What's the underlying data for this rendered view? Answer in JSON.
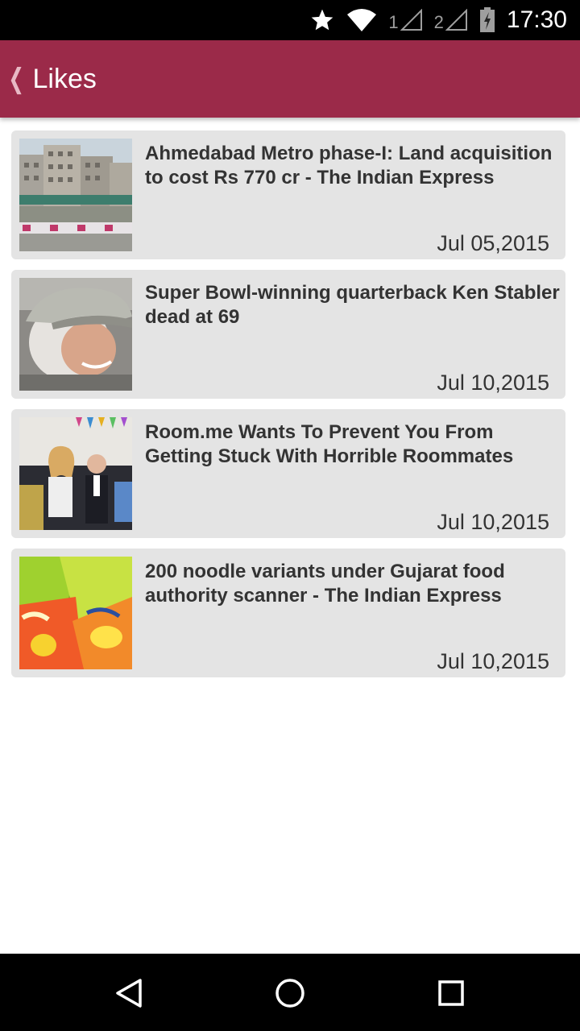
{
  "status_bar": {
    "time": "17:30",
    "sim1": "1",
    "sim2": "2",
    "icons": [
      "star-icon",
      "wifi-icon",
      "signal-icon",
      "signal-icon",
      "battery-charging-icon"
    ]
  },
  "app_bar": {
    "title": "Likes",
    "back_icon": "chevron-left-icon"
  },
  "articles": [
    {
      "title": "Ahmedabad Metro phase-I: Land acquisition to cost Rs 770 cr - The Indian Express",
      "date": "Jul 05,2015"
    },
    {
      "title": "Super Bowl-winning quarterback Ken Stabler dead at 69",
      "date": "Jul 10,2015"
    },
    {
      "title": "Room.me Wants To Prevent You From Getting Stuck With Horrible Roommates",
      "date": "Jul 10,2015"
    },
    {
      "title": "200 noodle variants under Gujarat food authority scanner - The Indian Express",
      "date": "Jul 10,2015"
    }
  ],
  "nav_bar": {
    "icons": [
      "back-triangle-icon",
      "home-circle-icon",
      "recents-square-icon"
    ]
  },
  "colors": {
    "app_bar": "#9b2a49",
    "card_bg": "#e4e4e4",
    "text": "#333333"
  }
}
